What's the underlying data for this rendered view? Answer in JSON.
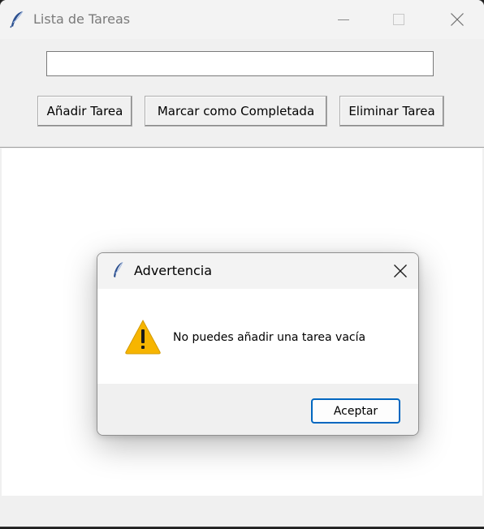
{
  "window": {
    "title": "Lista de Tareas",
    "controls": {
      "minimize": "minimize-icon",
      "maximize": "maximize-icon",
      "close": "close-icon"
    }
  },
  "task_input": {
    "value": "",
    "placeholder": ""
  },
  "buttons": {
    "add": "Añadir Tarea",
    "complete": "Marcar como Completada",
    "delete": "Eliminar Tarea"
  },
  "task_list": {
    "items": []
  },
  "dialog": {
    "title": "Advertencia",
    "icon": "warning-icon",
    "message": "No puedes añadir una tarea vacía",
    "ok_label": "Aceptar",
    "accent_color": "#0067c0"
  }
}
